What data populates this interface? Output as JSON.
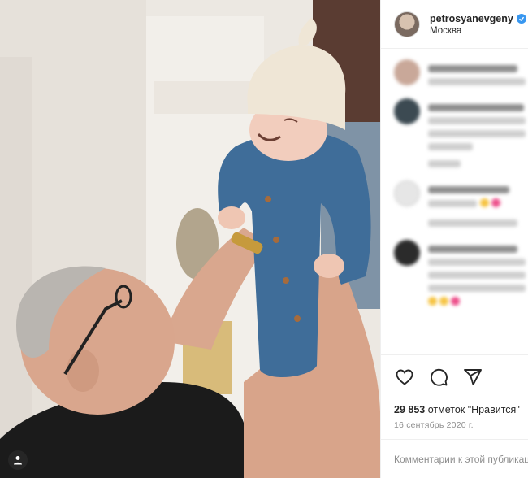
{
  "post": {
    "username": "petrosyanevgeny",
    "location": "Москва",
    "likes_count": "29 853",
    "likes_suffix": " отметок \"Нравится\"",
    "date": "16 сентябрь 2020 г.",
    "comment_placeholder": "Комментарии к этой публикации",
    "verified": true
  },
  "colors": {
    "verified_badge": "#3897f0",
    "text": "#262626",
    "secondary_text": "#8e8e8e",
    "border": "#efefef"
  },
  "icons": [
    "heart-icon",
    "comment-icon",
    "share-icon",
    "verified-icon",
    "user-tag-icon"
  ]
}
